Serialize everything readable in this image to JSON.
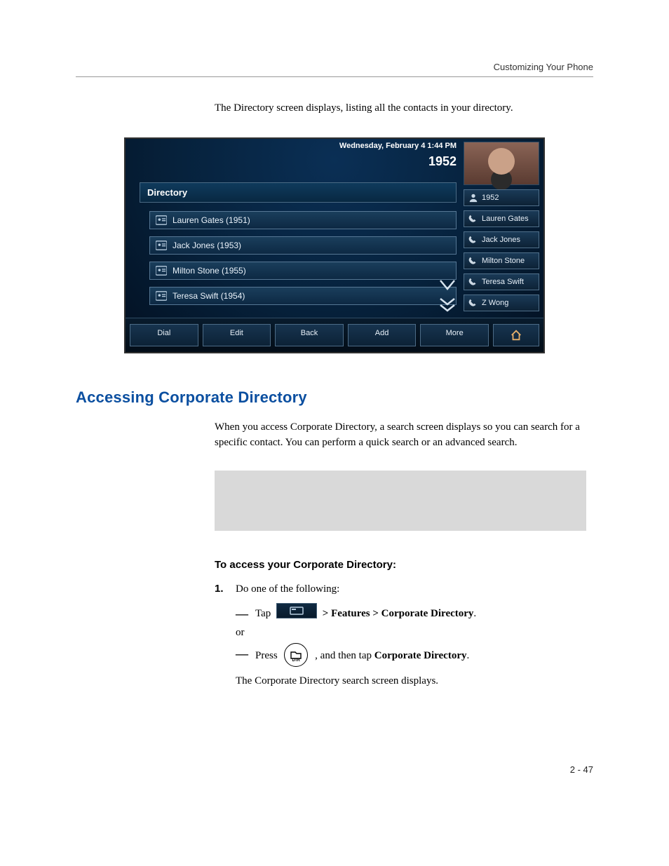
{
  "runningHead": "Customizing Your Phone",
  "intro": "The Directory screen displays, listing all the contacts in your directory.",
  "phone": {
    "datetime": "Wednesday, February 4  1:44 PM",
    "extension": "1952",
    "directoryTitle": "Directory",
    "contacts": [
      "Lauren Gates (1951)",
      "Jack Jones (1953)",
      "Milton Stone (1955)",
      "Teresa Swift (1954)"
    ],
    "side": [
      "1952",
      "Lauren Gates",
      "Jack Jones",
      "Milton Stone",
      "Teresa Swift",
      "Z Wong"
    ],
    "softkeys": [
      "Dial",
      "Edit",
      "Back",
      "Add",
      "More"
    ]
  },
  "h2": "Accessing Corporate Directory",
  "para1": "When you access Corporate Directory, a search screen displays so you can search for a specific contact. You can perform a quick search or an advanced search.",
  "h3": "To access your Corporate Directory:",
  "step1": "Do one of the following:",
  "sub1_pre": "Tap",
  "sub1_post": "> Features > Corporate Directory",
  "or": "or",
  "sub2_pre": "Press",
  "sub2_mid": ", and then tap ",
  "sub2_bold": "Corporate Directory",
  "dirKeyLabel": "DIR",
  "result": "The Corporate Directory search screen displays.",
  "pageNum": "2 - 47"
}
